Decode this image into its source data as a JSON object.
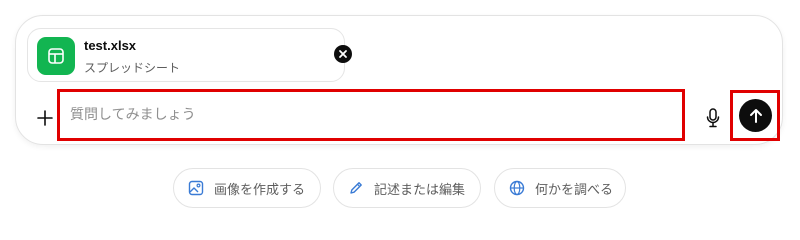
{
  "attachment": {
    "file_name": "test.xlsx",
    "file_type": "スプレッドシート",
    "icon": "spreadsheet-icon",
    "icon_color": "#12b551"
  },
  "composer": {
    "placeholder": "質問してみましょう",
    "add_icon": "plus-icon",
    "mic_icon": "microphone-icon",
    "send_icon": "arrow-up-icon",
    "highlight_color": "#e00000"
  },
  "suggestions": [
    {
      "label": "画像を作成する",
      "icon": "image-icon"
    },
    {
      "label": "記述または編集",
      "icon": "pencil-icon"
    },
    {
      "label": "何かを調べる",
      "icon": "globe-icon"
    }
  ]
}
